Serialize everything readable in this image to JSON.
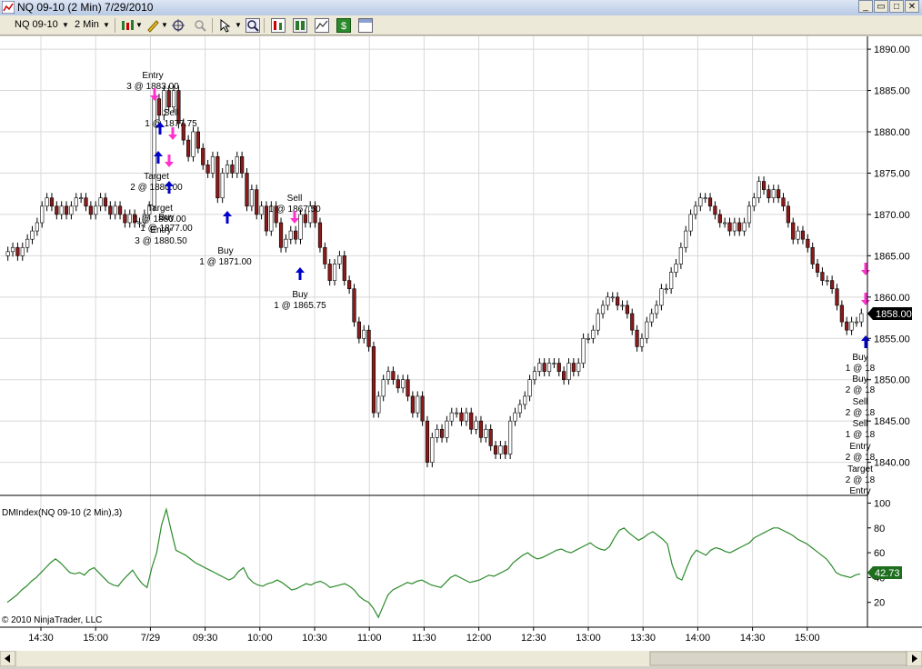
{
  "window": {
    "title": "NQ 09-10 (2 Min)  7/29/2010"
  },
  "toolbar": {
    "instrument": "NQ 09-10",
    "interval": "2 Min"
  },
  "chart_data": [
    {
      "type": "candlestick",
      "instrument": "NQ 09-10",
      "interval": "2 Min",
      "y_ticks": [
        "1890.00",
        "1885.00",
        "1880.00",
        "1875.00",
        "1870.00",
        "1865.00",
        "1860.00",
        "1855.00",
        "1850.00",
        "1845.00",
        "1840.00"
      ],
      "ylim": [
        1836,
        1891
      ],
      "x_ticks": [
        "14:30",
        "15:00",
        "7/29",
        "09:30",
        "10:00",
        "10:30",
        "11:00",
        "11:30",
        "12:00",
        "12:30",
        "13:00",
        "13:30",
        "14:00",
        "14:30",
        "15:00"
      ],
      "last_price": "1858.00",
      "close": [
        1865.5,
        1866,
        1865,
        1866,
        1867,
        1868,
        1869,
        1871,
        1872,
        1871,
        1870,
        1871,
        1870,
        1871,
        1872,
        1872,
        1871,
        1870,
        1871,
        1872,
        1871,
        1870,
        1871,
        1870,
        1869,
        1870,
        1869,
        1869,
        1870,
        1871,
        1884,
        1882,
        1885,
        1883,
        1885,
        1881,
        1879,
        1877,
        1880,
        1878,
        1876,
        1875,
        1877,
        1872,
        1875,
        1876,
        1875,
        1877,
        1875,
        1871,
        1873,
        1870,
        1871,
        1868,
        1871,
        1869,
        1866,
        1867,
        1868,
        1867,
        1870,
        1869,
        1871,
        1869,
        1866,
        1864,
        1862,
        1864,
        1865,
        1862,
        1861,
        1857,
        1855,
        1856,
        1854,
        1846,
        1848,
        1850,
        1851,
        1850,
        1849,
        1850,
        1848,
        1846,
        1848,
        1845,
        1840,
        1843,
        1844,
        1843,
        1845,
        1846,
        1846,
        1845,
        1846,
        1844,
        1845,
        1843,
        1844,
        1842,
        1841,
        1842,
        1841,
        1845,
        1846,
        1847,
        1848,
        1850,
        1851,
        1852,
        1851,
        1852,
        1852,
        1851,
        1850,
        1852,
        1851,
        1852,
        1855,
        1855,
        1856,
        1858,
        1859,
        1860,
        1860,
        1859,
        1859,
        1858,
        1856,
        1854,
        1855,
        1857,
        1858,
        1859,
        1861,
        1861,
        1863,
        1864,
        1866,
        1868,
        1870,
        1871,
        1872,
        1872,
        1871,
        1870,
        1869,
        1869,
        1868,
        1869,
        1868,
        1869,
        1871,
        1872,
        1874,
        1873,
        1872,
        1873,
        1872,
        1871,
        1869,
        1867,
        1868,
        1867,
        1866,
        1864,
        1863,
        1862,
        1862,
        1861,
        1859,
        1857,
        1856,
        1857,
        1857,
        1858
      ],
      "annotations": [
        {
          "label": "Entry",
          "price": "3 @ 1883.00",
          "side": "entry"
        },
        {
          "label": "Sell",
          "price": "1 @ 1877.75",
          "side": "sell"
        },
        {
          "label": "Target",
          "price": "2 @ 1880.00",
          "side": "target"
        },
        {
          "label": "Target",
          "price": "1 @ 1880.00",
          "side": "target"
        },
        {
          "label": "Entry",
          "price": "3 @ 1880.50",
          "side": "entry"
        },
        {
          "label": "Buy",
          "price": "1 @ 1877.00",
          "side": "buy"
        },
        {
          "label": "Buy",
          "price": "1 @ 1871.00",
          "side": "buy"
        },
        {
          "label": "Sell",
          "price": "1 @ 1867.50",
          "side": "sell"
        },
        {
          "label": "Buy",
          "price": "1 @ 1865.75",
          "side": "buy"
        },
        {
          "label": "Buy",
          "price": "1 @ 18",
          "side": "buy"
        },
        {
          "label": "Buy",
          "price": "2 @ 18",
          "side": "buy"
        },
        {
          "label": "Sell",
          "price": "2 @ 18",
          "side": "sell"
        },
        {
          "label": "Sell",
          "price": "1 @ 18",
          "side": "sell"
        },
        {
          "label": "Entry",
          "price": "2 @ 18",
          "side": "entry"
        },
        {
          "label": "Target",
          "price": "2 @ 18",
          "side": "target"
        },
        {
          "label": "Entry",
          "price": "",
          "side": "entry"
        }
      ],
      "colors": {
        "up": "#ffffff",
        "down": "#8b1a1a",
        "wick": "#000000",
        "buy_marker": "#0000cc",
        "sell_marker": "#ff33cc"
      }
    },
    {
      "type": "line",
      "indicator_label": "DMIndex(NQ 09-10 (2 Min),3)",
      "y_ticks": [
        "100",
        "80",
        "60",
        "40",
        "20"
      ],
      "ylim": [
        0,
        104
      ],
      "last_value": "42.73",
      "values": [
        20,
        23,
        26,
        30,
        33,
        37,
        40,
        44,
        48,
        52,
        55,
        52,
        48,
        44,
        43,
        44,
        42,
        46,
        48,
        44,
        40,
        36,
        34,
        33,
        38,
        42,
        46,
        40,
        35,
        32,
        48,
        60,
        82,
        95,
        78,
        62,
        60,
        58,
        55,
        52,
        50,
        48,
        46,
        44,
        42,
        40,
        38,
        40,
        45,
        48,
        40,
        36,
        34,
        33,
        35,
        36,
        38,
        36,
        33,
        30,
        31,
        33,
        35,
        34,
        36,
        37,
        35,
        32,
        33,
        34,
        35,
        33,
        30,
        25,
        22,
        20,
        15,
        8,
        17,
        26,
        30,
        32,
        34,
        36,
        35,
        37,
        38,
        36,
        34,
        33,
        32,
        36,
        40,
        42,
        40,
        38,
        36,
        37,
        38,
        40,
        42,
        41,
        43,
        45,
        47,
        52,
        55,
        58,
        60,
        57,
        55,
        56,
        58,
        60,
        62,
        63,
        61,
        60,
        62,
        64,
        66,
        68,
        65,
        63,
        62,
        65,
        72,
        78,
        80,
        76,
        73,
        70,
        72,
        75,
        77,
        74,
        71,
        67,
        50,
        40,
        38,
        48,
        57,
        62,
        60,
        58,
        62,
        64,
        63,
        61,
        60,
        62,
        64,
        66,
        68,
        72,
        74,
        76,
        78,
        80,
        80,
        78,
        76,
        74,
        71,
        69,
        67,
        64,
        61,
        58,
        55,
        50,
        44,
        42,
        41,
        40,
        42,
        43
      ]
    }
  ],
  "footer": {
    "copyright": "© 2010 NinjaTrader, LLC"
  }
}
